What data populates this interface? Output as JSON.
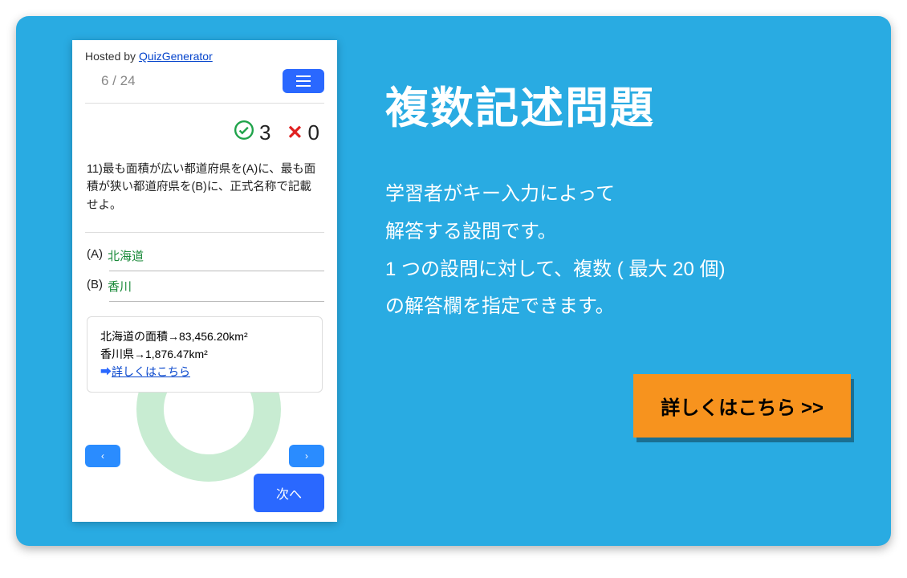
{
  "quiz": {
    "hosted_prefix": "Hosted by ",
    "hosted_link": "QuizGenerator",
    "progress": "6 / 24",
    "score_correct": "3",
    "score_wrong": "0",
    "question": "11)最も面積が広い都道府県を(A)に、最も面積が狭い都道府県を(B)に、正式名称で記載せよ。",
    "answers": {
      "a_label": "(A)",
      "a_value": "北海道",
      "b_label": "(B)",
      "b_value": "香川"
    },
    "explanation": {
      "line1": "北海道の面積→83,456.20km²",
      "line2": "香川県→1,876.47km²",
      "link_arrow": "➡",
      "link_text": "詳しくはこちら"
    },
    "nav": {
      "prev": "‹",
      "next_arrow": "›",
      "next_label": "次へ"
    }
  },
  "promo": {
    "heading": "複数記述問題",
    "desc_line1": "学習者がキー入力によって",
    "desc_line2": "解答する設問です。",
    "desc_line3": "1 つの設問に対して、複数 ( 最大 20 個)",
    "desc_line4": "の解答欄を指定できます。",
    "cta": "詳しくはこちら >>"
  }
}
